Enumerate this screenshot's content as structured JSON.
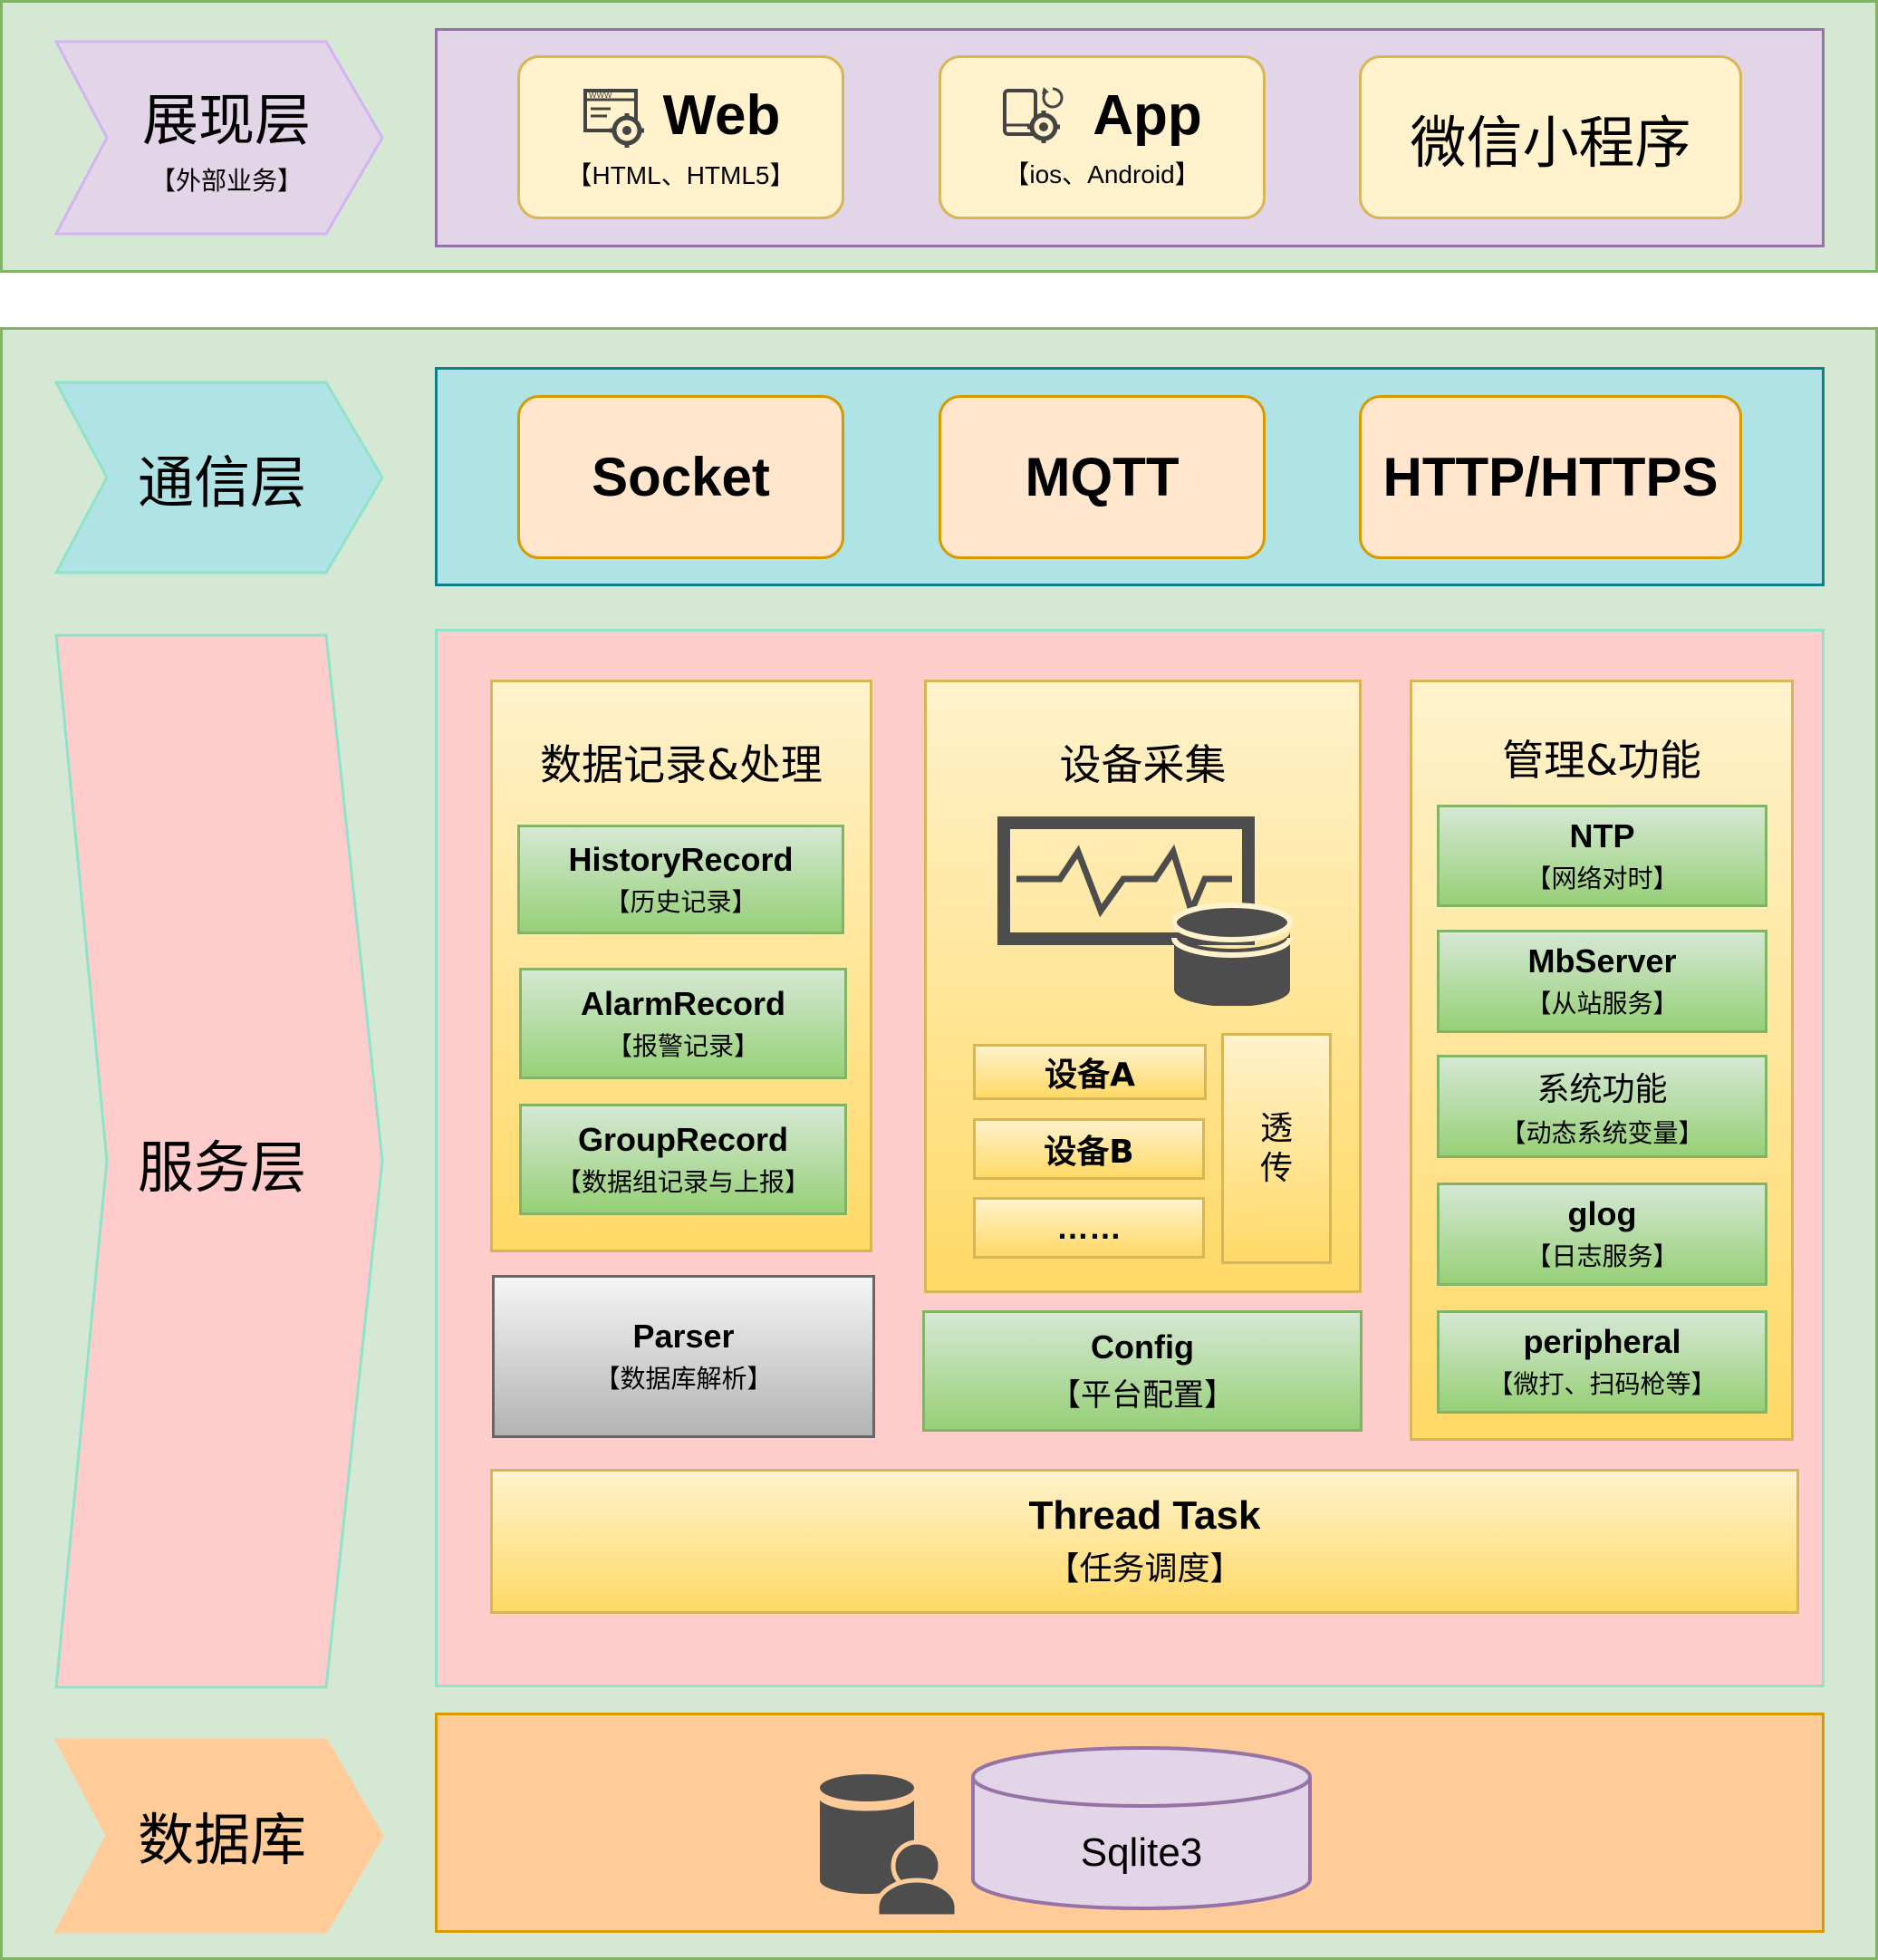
{
  "presentation": {
    "label": "展现层",
    "sublabel": "【外部业务】",
    "items": [
      {
        "title": "Web",
        "subtitle": "【HTML、HTML5】",
        "icon": "web-gear-icon"
      },
      {
        "title": "App",
        "subtitle": "【ios、Android】",
        "icon": "device-gear-icon"
      },
      {
        "title": "微信小程序"
      }
    ]
  },
  "communication": {
    "label": "通信层",
    "items": [
      "Socket",
      "MQTT",
      "HTTP/HTTPS"
    ]
  },
  "service": {
    "label": "服务层",
    "data_section": {
      "title": "数据记录&处理",
      "items": [
        {
          "name": "HistoryRecord",
          "desc": "【历史记录】"
        },
        {
          "name": "AlarmRecord",
          "desc": "【报警记录】"
        },
        {
          "name": "GroupRecord",
          "desc": "【数据组记录与上报】"
        }
      ]
    },
    "parser": {
      "name": "Parser",
      "desc": "【数据库解析】"
    },
    "device_section": {
      "title": "设备采集",
      "icon": "monitor-database-icon",
      "devices": [
        "设备A",
        "设备B",
        "……"
      ],
      "passthrough": "透传"
    },
    "config": {
      "name": "Config",
      "desc": "【平台配置】"
    },
    "manage_section": {
      "title": "管理&功能",
      "items": [
        {
          "name": "NTP",
          "desc": "【网络对时】"
        },
        {
          "name": "MbServer",
          "desc": "【从站服务】"
        },
        {
          "name": "系统功能",
          "desc": "【动态系统变量】"
        },
        {
          "name": "glog",
          "desc": "【日志服务】"
        },
        {
          "name": "peripheral",
          "desc": "【微打、扫码枪等】"
        }
      ]
    },
    "thread": {
      "name": "Thread Task",
      "desc": "【任务调度】"
    }
  },
  "database": {
    "label": "数据库",
    "icon": "database-user-icon",
    "engine": "Sqlite3"
  },
  "colors": {
    "frame": "#d5e8d4",
    "presentation": "#e1d5e7",
    "communication": "#b0e3e6",
    "service": "#ffcccc",
    "database": "#ffcc99"
  }
}
